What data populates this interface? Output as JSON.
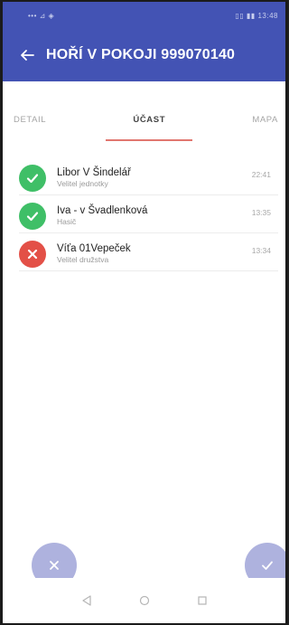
{
  "statusbar": {
    "left_text": "••• ⊿ ◈",
    "right_text": "▯▯ ▮▮ 13:48"
  },
  "appbar": {
    "title": "HOŘÍ V POKOJI 999070140"
  },
  "tabs": [
    {
      "label": "DETAIL",
      "active": false
    },
    {
      "label": "ÚČAST",
      "active": true
    },
    {
      "label": "MAPA",
      "active": false
    }
  ],
  "participants": [
    {
      "name": "Libor V Šindelář",
      "role": "Velitel jednotky",
      "time": "22:41",
      "status": "accepted"
    },
    {
      "name": "Iva - v Švadlenková",
      "role": "Hasič",
      "time": "13:35",
      "status": "accepted"
    },
    {
      "name": "Víťa 01Vepeček",
      "role": "Velitel družstva",
      "time": "13:34",
      "status": "declined"
    }
  ],
  "actions": {
    "decline_icon": "close-icon",
    "accept_icon": "check-icon"
  },
  "colors": {
    "primary": "#4353b4",
    "accent": "#e1766f",
    "accepted": "#3fbf67",
    "declined": "#e35047",
    "fab": "#aeb2de"
  }
}
